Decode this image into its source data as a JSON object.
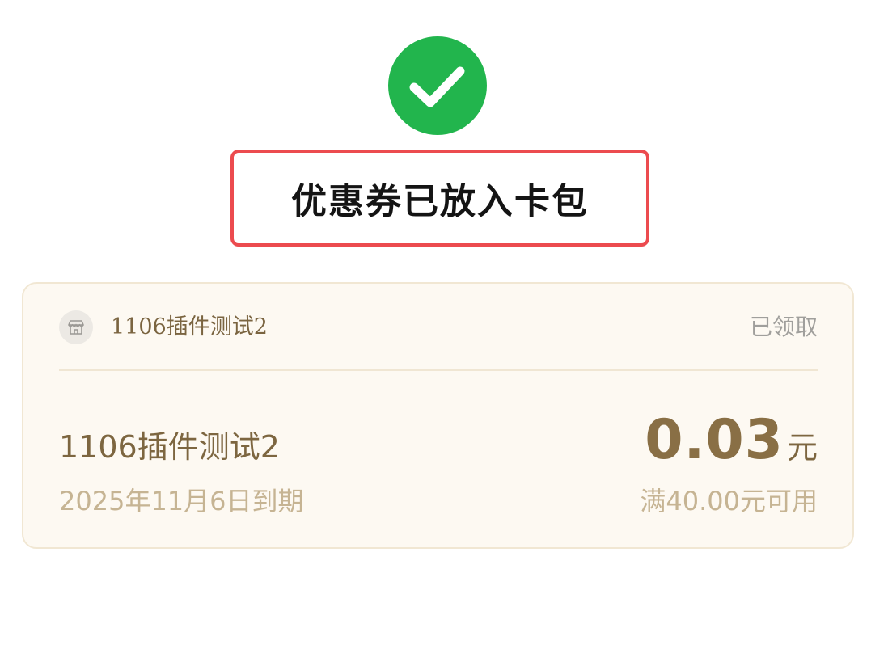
{
  "result": {
    "icon": "check-circle-icon",
    "icon_color": "#22b54d",
    "message": "优惠券已放入卡包",
    "highlight_border_color": "#ec4b4f"
  },
  "coupon": {
    "store_icon": "store-icon",
    "store_name": "1106插件测试2",
    "status": "已领取",
    "name": "1106插件测试2",
    "expiry": "2025年11月6日到期",
    "amount": "0.03",
    "amount_unit": "元",
    "condition": "满40.00元可用",
    "accent_color": "#896f45",
    "card_background": "#fdf9f2"
  }
}
